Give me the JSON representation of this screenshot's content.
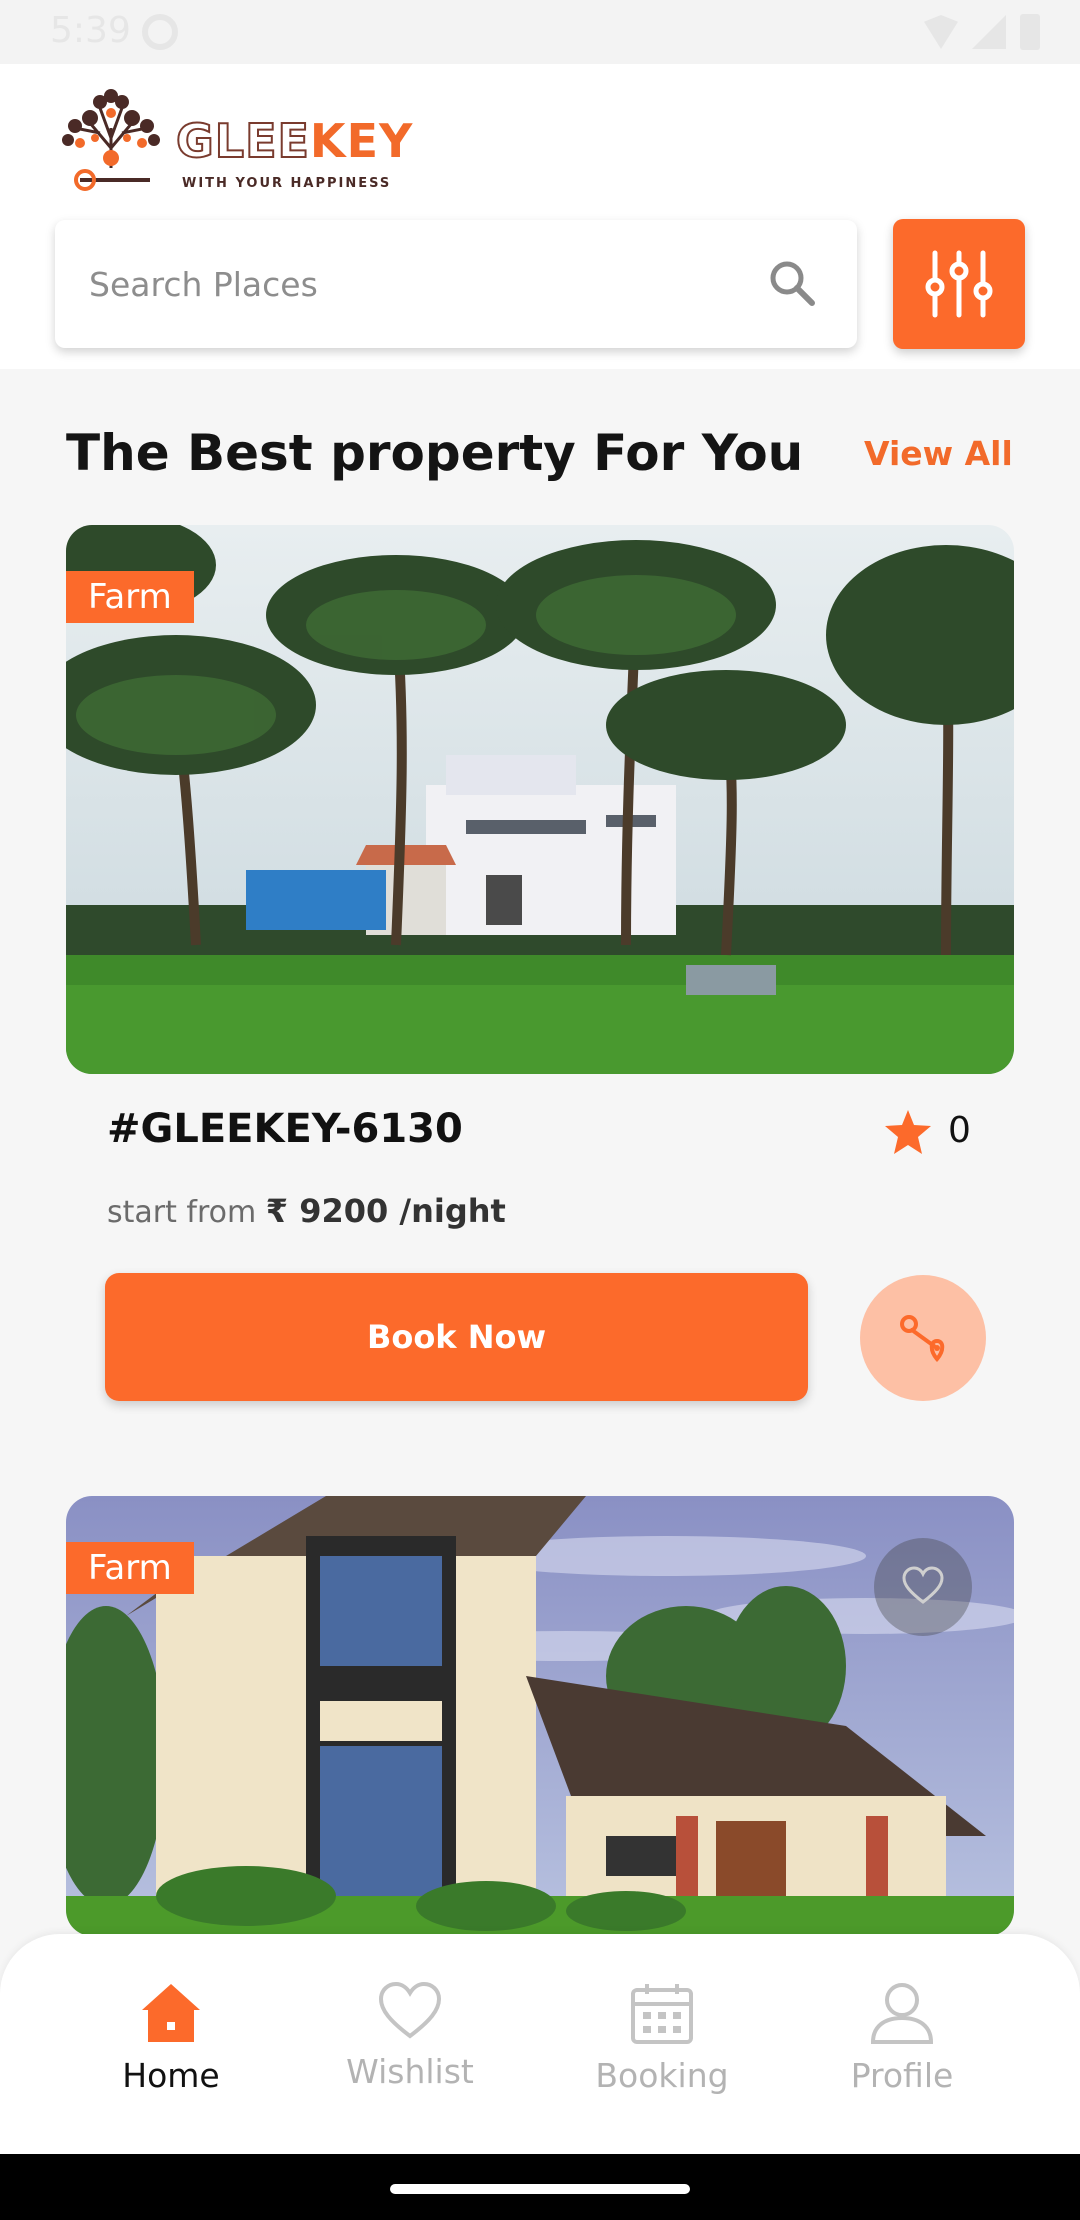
{
  "status_bar": {
    "time": "5:39"
  },
  "brand": {
    "name_part1": "GLEE",
    "name_part2": "KEY",
    "tagline": "WITH YOUR HAPPINESS",
    "accent_color": "#fc6a2b"
  },
  "search": {
    "placeholder": "Search Places",
    "value": ""
  },
  "section": {
    "title": "The Best property For You",
    "view_all": "View All"
  },
  "properties": [
    {
      "category": "Farm",
      "code": "#GLEEKEY-6130",
      "rating": "0",
      "price_prefix": "start from",
      "price": "₹ 9200 /night",
      "book_label": "Book Now"
    },
    {
      "category": "Farm"
    }
  ],
  "nav": {
    "items": [
      {
        "label": "Home",
        "icon": "home-icon",
        "active": true
      },
      {
        "label": "Wishlist",
        "icon": "heart-icon",
        "active": false
      },
      {
        "label": "Booking",
        "icon": "calendar-icon",
        "active": false
      },
      {
        "label": "Profile",
        "icon": "user-icon",
        "active": false
      }
    ]
  }
}
